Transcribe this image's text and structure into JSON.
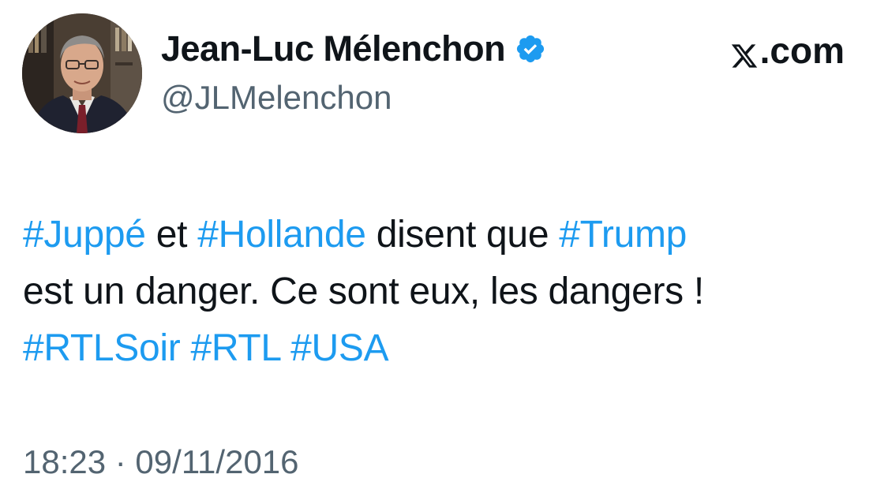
{
  "author": {
    "display_name": "Jean-Luc Mélenchon",
    "handle": "@JLMelenchon",
    "verified_icon": "verified-badge-icon",
    "verified_color": "#1d9bf0"
  },
  "brand": {
    "logo_icon": "x-logo-icon",
    "text": ".com"
  },
  "tweet": {
    "line1": {
      "tag1": "#Juppé",
      "t1": " et ",
      "tag2": "#Hollande",
      "t2": " disent que ",
      "tag3": "#Trump"
    },
    "line2": "est un danger. Ce sont eux, les dangers !",
    "line3": {
      "tag1": "#RTLSoir",
      "tag2": "#RTL",
      "tag3": "#USA"
    }
  },
  "meta": {
    "timestamp": "18:23 · 09/11/2016"
  },
  "colors": {
    "text": "#0f1419",
    "secondary": "#536471",
    "accent": "#1d9bf0"
  }
}
